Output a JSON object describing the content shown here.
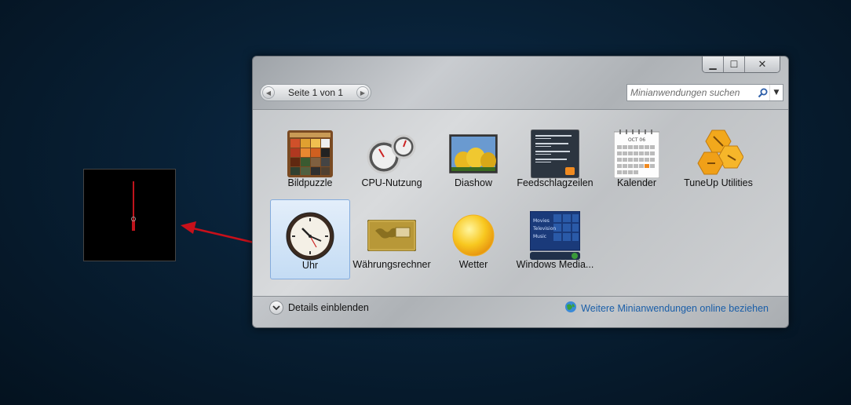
{
  "window": {
    "caption": {
      "minimize": "▁",
      "maximize": "☐",
      "close": "✕"
    },
    "pager": {
      "text": "Seite 1 von 1"
    },
    "search": {
      "placeholder": "Minianwendungen suchen"
    }
  },
  "gadgets": [
    {
      "label": "Bildpuzzle",
      "icon": "picture-puzzle-icon",
      "selected": false
    },
    {
      "label": "CPU-Nutzung",
      "icon": "cpu-meter-icon",
      "selected": false
    },
    {
      "label": "Diashow",
      "icon": "slideshow-icon",
      "selected": false
    },
    {
      "label": "Feedschlagzeilen",
      "icon": "feed-headlines-icon",
      "selected": false
    },
    {
      "label": "Kalender",
      "icon": "calendar-icon",
      "selected": false
    },
    {
      "label": "TuneUp Utilities",
      "icon": "tuneup-icon",
      "selected": false
    },
    {
      "label": "Uhr",
      "icon": "clock-icon",
      "selected": true
    },
    {
      "label": "Währungsrechner",
      "icon": "currency-icon",
      "selected": false
    },
    {
      "label": "Wetter",
      "icon": "weather-icon",
      "selected": false
    },
    {
      "label": "Windows Media...",
      "icon": "media-center-icon",
      "selected": false
    }
  ],
  "calendar_thumb": {
    "month": "OCT 06"
  },
  "media_thumb": {
    "items": [
      "Movies",
      "Television",
      "Music"
    ]
  },
  "footer": {
    "details": "Details einblenden",
    "online_link": "Weitere Minianwendungen online beziehen"
  },
  "colors": {
    "link": "#1a5ea8",
    "selection": "#c4dcf4",
    "clock_hand": "#c0141c",
    "arrow": "#c8101a"
  }
}
